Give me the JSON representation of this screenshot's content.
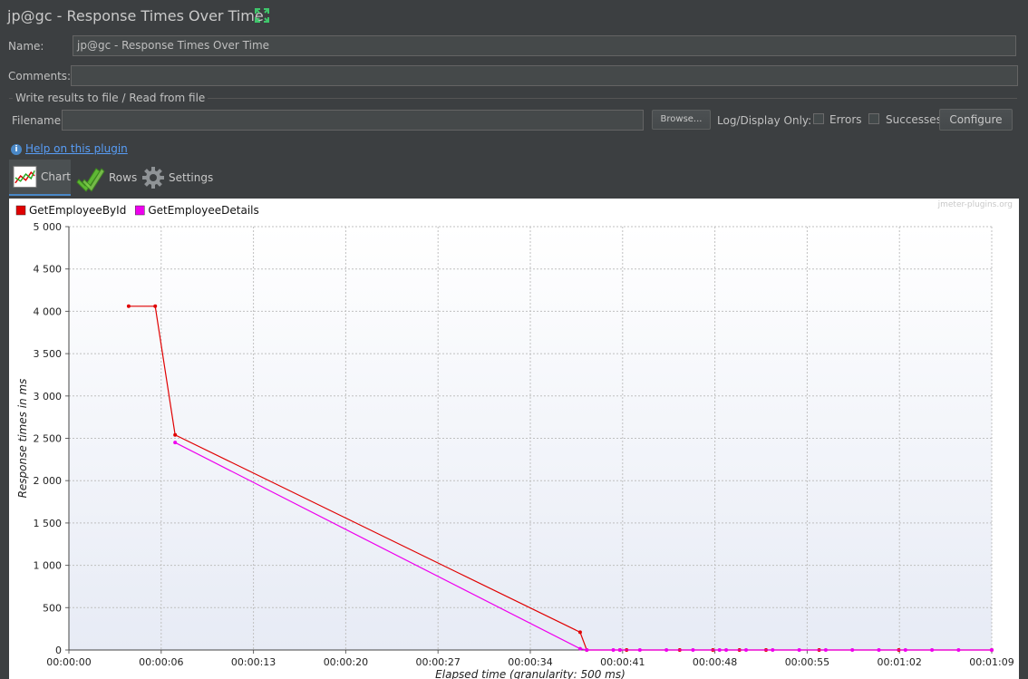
{
  "window": {
    "title": "jp@gc - Response Times Over Time"
  },
  "form": {
    "name_label": "Name:",
    "name_value": "jp@gc - Response Times Over Time",
    "comments_label": "Comments:",
    "comments_value": "",
    "file_group_title": "Write results to file / Read from file",
    "filename_label": "Filename",
    "filename_value": "",
    "browse_label": "Browse...",
    "log_display_label": "Log/Display Only:",
    "errors_label": "Errors",
    "successes_label": "Successes",
    "configure_label": "Configure",
    "help_link": "Help on this plugin"
  },
  "tabs": [
    {
      "label": "Chart",
      "icon": "chart-icon",
      "selected": true
    },
    {
      "label": "Rows",
      "icon": "checkmark-icon",
      "selected": false
    },
    {
      "label": "Settings",
      "icon": "gear-icon",
      "selected": false
    }
  ],
  "chart_data": {
    "type": "line",
    "watermark": "jmeter-plugins.org",
    "xlabel": "Elapsed time (granularity: 500 ms)",
    "ylabel": "Response times in ms",
    "ylim": [
      0,
      5000
    ],
    "yticks": [
      0,
      500,
      1000,
      1500,
      2000,
      2500,
      3000,
      3500,
      4000,
      4500,
      5000
    ],
    "ytick_labels": [
      "0",
      "500",
      "1 000",
      "1 500",
      "2 000",
      "2 500",
      "3 000",
      "3 500",
      "4 000",
      "4 500",
      "5 000"
    ],
    "xlim": [
      0,
      69.5
    ],
    "xtick_labels": [
      "00:00:00",
      "00:00:06",
      "00:00:13",
      "00:00:20",
      "00:00:27",
      "00:00:34",
      "00:00:41",
      "00:00:48",
      "00:00:55",
      "00:01:02",
      "00:01:09"
    ],
    "grid": true,
    "legend_position": "top-left",
    "series": [
      {
        "name": "GetEmployeeById",
        "color": "#e00000",
        "points": [
          [
            4.5,
            4060
          ],
          [
            6.5,
            4060
          ],
          [
            8.0,
            2540
          ],
          [
            38.5,
            210
          ],
          [
            39.0,
            0
          ],
          [
            41.5,
            0
          ],
          [
            42.0,
            0
          ],
          [
            46.0,
            0
          ],
          [
            48.5,
            0
          ],
          [
            50.5,
            0
          ],
          [
            52.5,
            0
          ],
          [
            56.5,
            0
          ],
          [
            62.5,
            0
          ],
          [
            69.5,
            0
          ]
        ]
      },
      {
        "name": "GetEmployeeDetails",
        "color": "#ee00ee",
        "points": [
          [
            8.0,
            2450
          ],
          [
            38.5,
            15
          ],
          [
            39.0,
            0
          ],
          [
            41.0,
            0
          ],
          [
            41.5,
            0
          ],
          [
            43.0,
            0
          ],
          [
            45.0,
            0
          ],
          [
            47.0,
            0
          ],
          [
            49.0,
            0
          ],
          [
            49.5,
            0
          ],
          [
            51.0,
            0
          ],
          [
            53.0,
            0
          ],
          [
            55.0,
            0
          ],
          [
            57.0,
            0
          ],
          [
            59.0,
            0
          ],
          [
            61.0,
            0
          ],
          [
            63.0,
            0
          ],
          [
            65.0,
            0
          ],
          [
            67.0,
            0
          ],
          [
            69.5,
            0
          ]
        ]
      }
    ]
  }
}
